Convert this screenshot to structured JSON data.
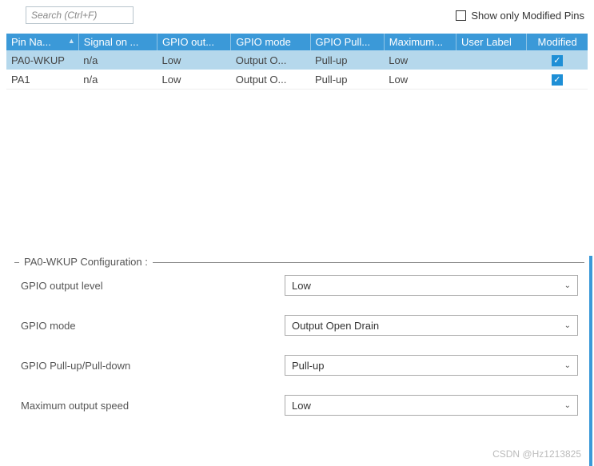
{
  "top": {
    "search_placeholder": "Search (Ctrl+F)",
    "show_only_label": "Show only Modified Pins"
  },
  "table": {
    "headers": {
      "pin_name": "Pin Na...",
      "signal": "Signal on ...",
      "gpio_out": "GPIO out...",
      "gpio_mode": "GPIO mode",
      "gpio_pull": "GPIO Pull...",
      "maximum": "Maximum...",
      "user_label": "User Label",
      "modified": "Modified"
    },
    "rows": [
      {
        "pin_name": "PA0-WKUP",
        "signal": "n/a",
        "gpio_out": "Low",
        "gpio_mode": "Output O...",
        "gpio_pull": "Pull-up",
        "maximum": "Low",
        "user_label": "",
        "modified_check": "✓"
      },
      {
        "pin_name": "PA1",
        "signal": "n/a",
        "gpio_out": "Low",
        "gpio_mode": "Output O...",
        "gpio_pull": "Pull-up",
        "maximum": "Low",
        "user_label": "",
        "modified_check": "✓"
      }
    ]
  },
  "config": {
    "title": "PA0-WKUP Configuration :",
    "rows": [
      {
        "label": "GPIO output level",
        "value": "Low"
      },
      {
        "label": "GPIO mode",
        "value": "Output Open Drain"
      },
      {
        "label": "GPIO Pull-up/Pull-down",
        "value": "Pull-up"
      },
      {
        "label": "Maximum output speed",
        "value": "Low"
      }
    ]
  },
  "watermark": "CSDN @Hz1213825"
}
